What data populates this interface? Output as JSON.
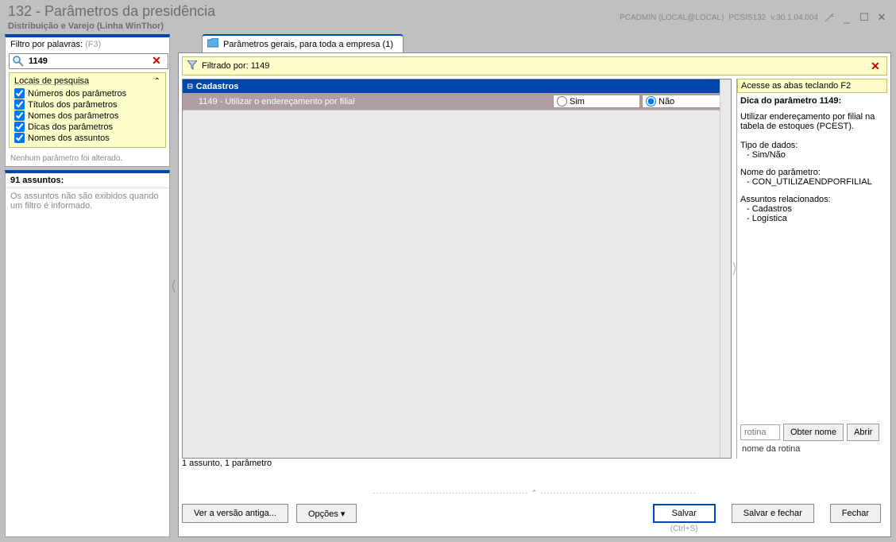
{
  "title": "132 - Parâmetros da presidência",
  "subtitle": "Distribuição e Varejo (Linha WinThor)",
  "meta_user": "PCADMIN (LOCAL@LOCAL)",
  "meta_app": "PCSIS132",
  "meta_ver": "v.30.1.04.004",
  "left": {
    "filter_label": "Filtro por palavras:",
    "filter_hint": "(F3)",
    "filter_value": "1149",
    "places_header": "Locais de pesquisa",
    "checks": {
      "nums": "Números dos parâmetros",
      "titles": "Títulos dos parâmetros",
      "names": "Nomes dos parâmetros",
      "tips": "Dicas dos parâmetros",
      "subj": "Nomes dos assuntos"
    },
    "status": "Nenhum parâmetro foi alterado.",
    "subjects_header": "91 assuntos:",
    "subjects_body": "Os assuntos não são exibidos quando um filtro é informado."
  },
  "tab": {
    "label": "Parâmetros gerais, para toda a empresa  (1)"
  },
  "filterbar": {
    "text": "Filtrado por: 1149"
  },
  "grid": {
    "group": "Cadastros",
    "row_label": "1149 - Utilizar o endereçamento por filial",
    "opt_yes": "Sim",
    "opt_no": "Não"
  },
  "grid_footer": "1 assunto, 1 parâmetro",
  "right": {
    "tabs_hint": "Acesse as abas teclando F2",
    "tip_title": "Dica do parâmetro 1149:",
    "tip_body": "Utilizar endereçamento por filial na tabela de estoques (PCEST).",
    "type_label": "Tipo de dados:",
    "type_value": "- Sim/Não",
    "name_label": "Nome do parâmetro:",
    "name_value": "- CON_UTILIZAENDPORFILIAL",
    "subjects_label": "Assuntos relacionados:",
    "subjects": [
      "- Cadastros",
      "- Logística"
    ],
    "routine_placeholder": "rotina",
    "obter_nome": "Obter nome",
    "abrir": "Abrir",
    "routine_name": "nome da rotina"
  },
  "bottom": {
    "old_version": "Ver a versão antiga...",
    "options": "Opções ▾",
    "salvar": "Salvar",
    "salvar_shortcut": "(Ctrl+S)",
    "salvar_fechar": "Salvar e fechar",
    "fechar": "Fechar"
  }
}
